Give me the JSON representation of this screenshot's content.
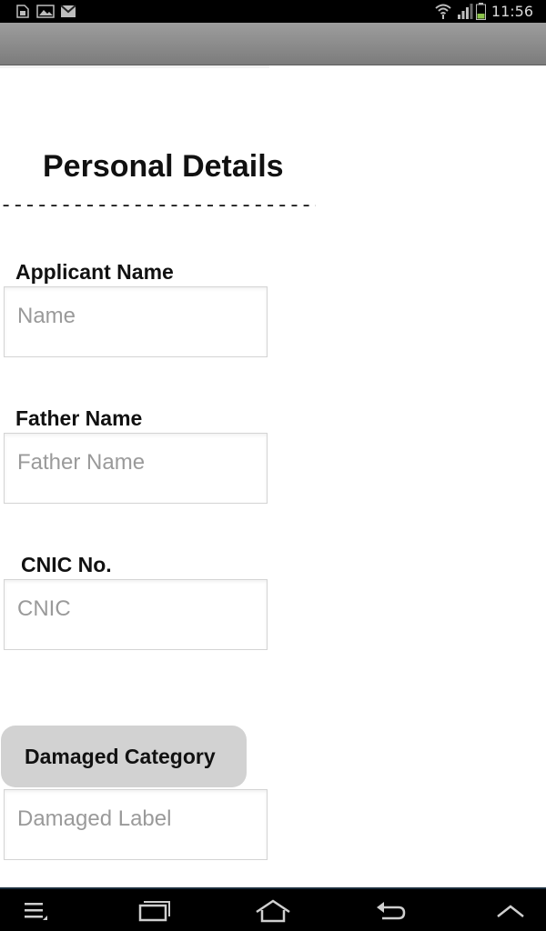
{
  "status_bar": {
    "time": "11:56",
    "icons": [
      "sim-card-icon",
      "image-icon",
      "gmail-icon",
      "wifi-icon",
      "signal-icon",
      "battery-icon"
    ]
  },
  "form": {
    "heading": "Personal Details",
    "divider": "------------------------------",
    "applicant": {
      "label": "Applicant Name",
      "placeholder": "Name"
    },
    "father": {
      "label": "Father Name",
      "placeholder": "Father Name"
    },
    "cnic": {
      "label": "CNIC No.",
      "placeholder": "CNIC"
    },
    "damaged": {
      "button_label": "Damaged Category",
      "placeholder": "Damaged Label"
    }
  },
  "nav_bar": {
    "icons": [
      "menu-icon",
      "recent-apps-icon",
      "home-icon",
      "back-icon",
      "up-icon"
    ]
  },
  "colors": {
    "action_bar": "#8a8a8a",
    "battery": "#8bc34a",
    "button_bg": "#d2d2d2"
  }
}
